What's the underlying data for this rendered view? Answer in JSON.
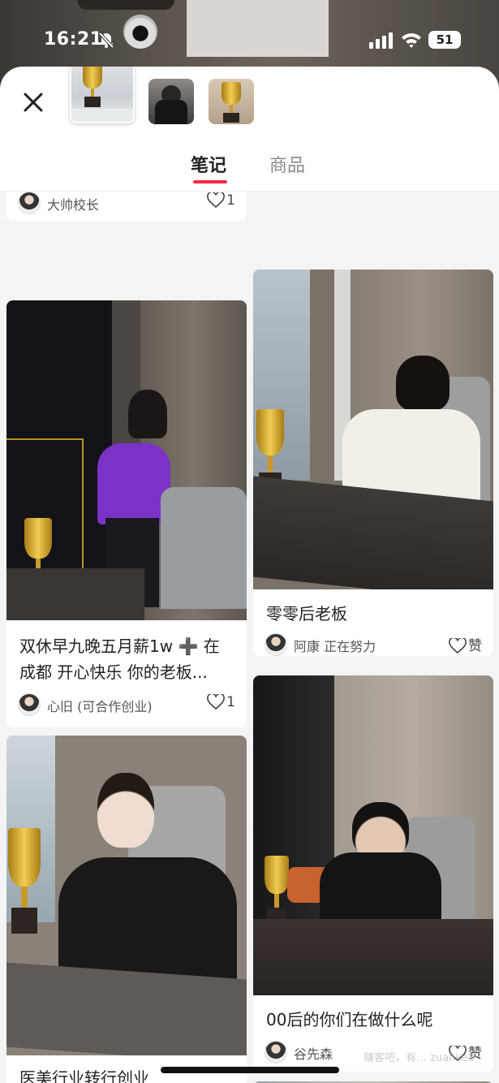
{
  "status_bar": {
    "time": "16:21",
    "battery": "51"
  },
  "tabs": [
    {
      "label": "笔记"
    },
    {
      "label": "商品"
    }
  ],
  "icons": {
    "close": "close-icon",
    "bell": "bell-slash-icon",
    "heart": "heart-outline-icon"
  },
  "colors": {
    "accent": "#ff2742"
  },
  "feed": {
    "top_partial": {
      "author": "大帅校长",
      "likes": "1"
    },
    "cards": [
      {
        "title": "双休早九晚五月薪1w ➕ 在成都 开心快乐 你的老板...",
        "author": "心旧 (可合作创业)",
        "likes": "1"
      },
      {
        "title": "零零后老板",
        "author": "阿康 正在努力",
        "likes": "赞"
      },
      {
        "title": "医美行业转行创业"
      },
      {
        "title": "00后的你们在做什么呢",
        "author": "谷先森",
        "likes": "赞"
      }
    ]
  },
  "watermark": "赚客吧，有…  zuanke8"
}
